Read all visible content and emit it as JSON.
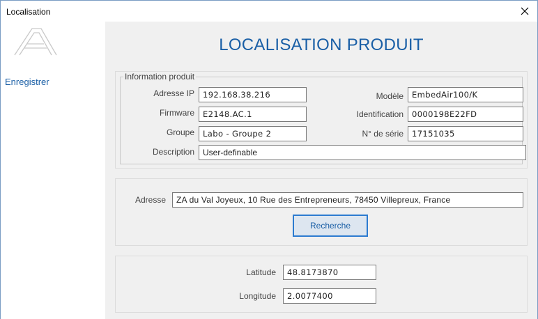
{
  "window": {
    "title": "Localisation"
  },
  "sidebar": {
    "save_label": "Enregistrer"
  },
  "main": {
    "title": "LOCALISATION PRODUIT"
  },
  "product_info": {
    "legend": "Information produit",
    "ip_label": "Adresse IP",
    "ip_value": "192.168.38.216",
    "firmware_label": "Firmware",
    "firmware_value": "E2148.AC.1",
    "group_label": "Groupe",
    "group_value": "Labo - Groupe 2",
    "description_label": "Description",
    "description_value": "User-definable",
    "model_label": "Modèle",
    "model_value": "EmbedAir100/K",
    "id_label": "Identification",
    "id_value": "0000198E22FD",
    "serial_label": "N° de série",
    "serial_value": "17151035"
  },
  "address": {
    "label": "Adresse",
    "value": "ZA du Val Joyeux, 10 Rue des Entrepreneurs, 78450 Villepreux, France",
    "search_button": "Recherche"
  },
  "coordinates": {
    "latitude_label": "Latitude",
    "latitude_value": "48.8173870",
    "longitude_label": "Longitude",
    "longitude_value": "2.0077400"
  }
}
